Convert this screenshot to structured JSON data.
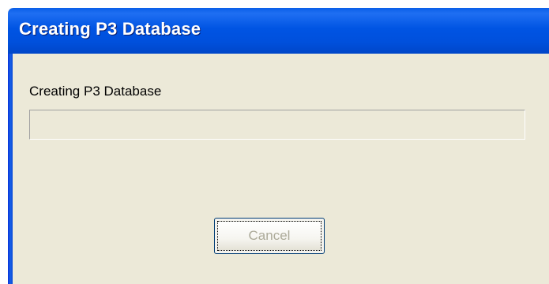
{
  "window": {
    "title": "Creating P3 Database"
  },
  "dialog": {
    "status_label": "Creating P3 Database",
    "progress_percent": 0,
    "cancel_label": "Cancel",
    "cancel_enabled": false
  },
  "colors": {
    "titlebar": "#0054e3",
    "dialog_background": "#ece9d8",
    "disabled_text": "#acaa99",
    "progress_fill": "#2bb33b"
  }
}
